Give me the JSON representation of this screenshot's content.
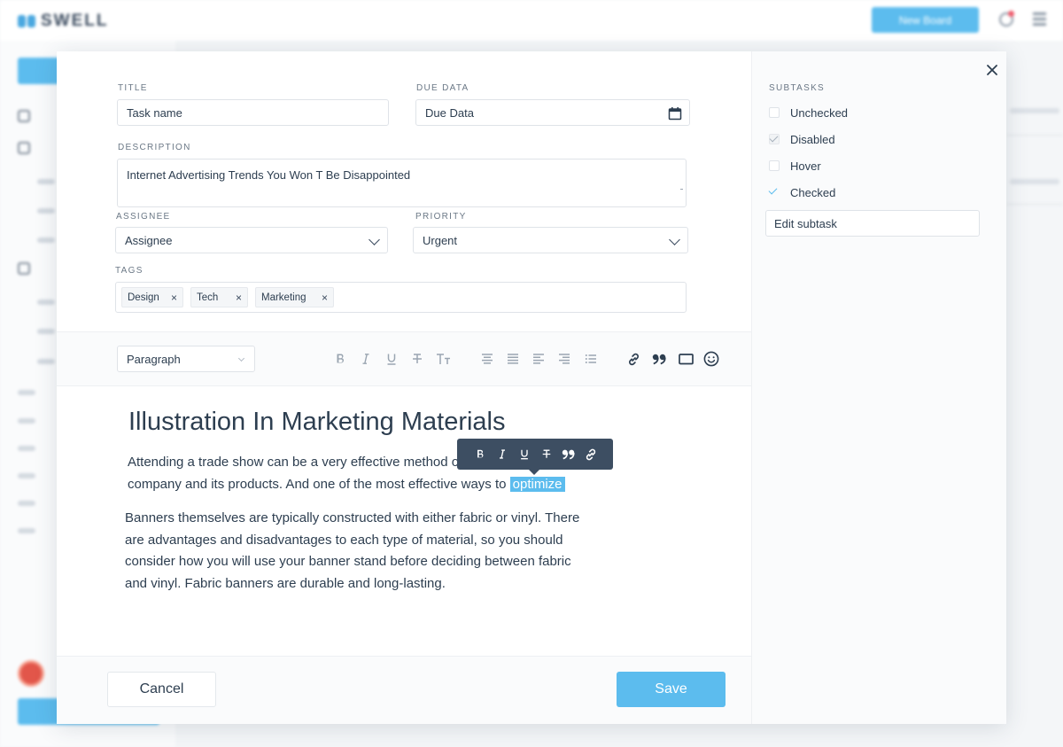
{
  "app": {
    "logo_text": "SWELL",
    "new_board_label": "New Board"
  },
  "modal": {
    "title": {
      "label": "Title",
      "value": "Task name"
    },
    "due": {
      "label": "Due Data",
      "value": "Due Data"
    },
    "description": {
      "label": "Description",
      "value": "Internet Advertising Trends You Won T Be Disappointed"
    },
    "assignee": {
      "label": "Assignee",
      "value": "Assignee"
    },
    "priority": {
      "label": "Priority",
      "value": "Urgent"
    },
    "tags": {
      "label": "Tags",
      "items": [
        "Design",
        "Tech",
        "Marketing"
      ],
      "remove_glyph": "×"
    },
    "toolbar": {
      "block_format": "Paragraph"
    },
    "editor": {
      "heading": "Illustration In Marketing Materials",
      "p1_before": "Attending a trade show can be a very effective method o",
      "p1_line2": "company and its products. And one of the most effective ways to",
      "p1_highlight": "optimize",
      "p2": "Banners themselves are typically constructed with either fabric or vinyl. There are advantages and disadvantages to each type of material, so you should consider how you will use your banner stand before deciding between fabric and vinyl. Fabric banners are durable and long-lasting."
    },
    "footer": {
      "cancel_label": "Cancel",
      "save_label": "Save"
    },
    "subtasks": {
      "label": "Subtasks",
      "items": [
        {
          "label": "Unchecked",
          "state": "unchecked"
        },
        {
          "label": "Disabled",
          "state": "disabled"
        },
        {
          "label": "Hover",
          "state": "hover"
        },
        {
          "label": "Checked",
          "state": "checked"
        }
      ],
      "edit_value": "Edit subtask"
    }
  },
  "colors": {
    "accent": "#5cbcee",
    "text": "#2d3e50",
    "float_toolbar": "#3d4e62",
    "border": "#dfe3e8"
  }
}
